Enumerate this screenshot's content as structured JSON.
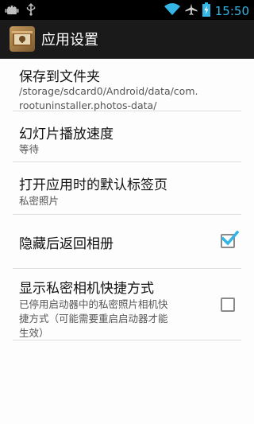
{
  "status_bar": {
    "time": "15:50",
    "left_icons": [
      "android-icon",
      "usb-icon"
    ],
    "right_icons": [
      "wifi-icon",
      "airplane-icon",
      "battery-charging-icon"
    ]
  },
  "action_bar": {
    "title": "应用设置",
    "icon": "app-icon"
  },
  "settings": {
    "items": [
      {
        "title": "保存到文件夹",
        "summary": "/storage/sdcard0/Android/data/com.\nrootuninstaller.photos-data/"
      },
      {
        "title": "幻灯片播放速度",
        "summary": "等待"
      },
      {
        "title": "打开应用时的默认标签页",
        "summary": "私密照片"
      },
      {
        "title": "隐藏后返回相册",
        "checked": true
      },
      {
        "title": "显示私密相机快捷方式",
        "summary": "已停用启动器中的私密照片相机快\n捷方式（可能需要重启启动器才能\n生效）",
        "checked": false
      }
    ]
  },
  "colors": {
    "status_time": "#33b5e5",
    "checkbox_checked": "#33b5e5"
  }
}
